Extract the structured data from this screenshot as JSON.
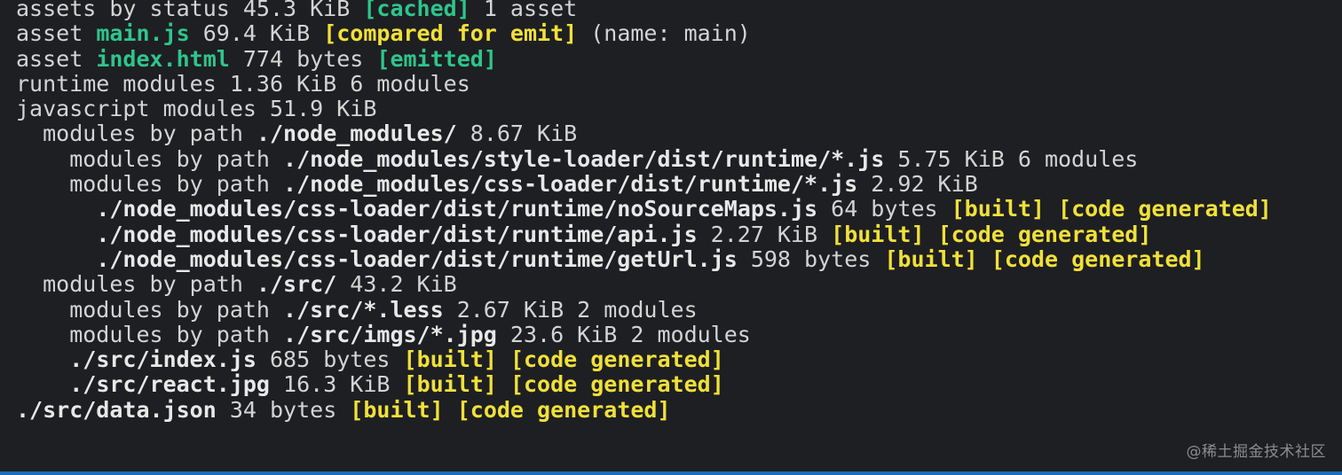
{
  "lines": [
    [
      {
        "t": "assets by status 45.3 KiB "
      },
      {
        "t": "[cached]",
        "c": "g"
      },
      {
        "t": " 1 asset"
      }
    ],
    [
      {
        "t": "asset "
      },
      {
        "t": "main.js",
        "c": "g"
      },
      {
        "t": " 69.4 KiB "
      },
      {
        "t": "[compared for emit]",
        "c": "y"
      },
      {
        "t": " (name: main)"
      }
    ],
    [
      {
        "t": "asset "
      },
      {
        "t": "index.html",
        "c": "g"
      },
      {
        "t": " 774 bytes "
      },
      {
        "t": "[emitted]",
        "c": "g"
      }
    ],
    [
      {
        "t": "runtime modules 1.36 KiB 6 modules"
      }
    ],
    [
      {
        "t": "javascript modules 51.9 KiB"
      }
    ],
    [
      {
        "t": "  modules by path "
      },
      {
        "t": "./node_modules/",
        "c": "w"
      },
      {
        "t": " 8.67 KiB"
      }
    ],
    [
      {
        "t": "    modules by path "
      },
      {
        "t": "./node_modules/style-loader/dist/runtime/*.js",
        "c": "w"
      },
      {
        "t": " 5.75 KiB 6 modules"
      }
    ],
    [
      {
        "t": "    modules by path "
      },
      {
        "t": "./node_modules/css-loader/dist/runtime/*.js",
        "c": "w"
      },
      {
        "t": " 2.92 KiB"
      }
    ],
    [
      {
        "t": "      "
      },
      {
        "t": "./node_modules/css-loader/dist/runtime/noSourceMaps.js",
        "c": "w"
      },
      {
        "t": " 64 bytes "
      },
      {
        "t": "[built]",
        "c": "y"
      },
      {
        "t": " "
      },
      {
        "t": "[code generated]",
        "c": "y"
      }
    ],
    [
      {
        "t": "      "
      },
      {
        "t": "./node_modules/css-loader/dist/runtime/api.js",
        "c": "w"
      },
      {
        "t": " 2.27 KiB "
      },
      {
        "t": "[built]",
        "c": "y"
      },
      {
        "t": " "
      },
      {
        "t": "[code generated]",
        "c": "y"
      }
    ],
    [
      {
        "t": "      "
      },
      {
        "t": "./node_modules/css-loader/dist/runtime/getUrl.js",
        "c": "w"
      },
      {
        "t": " 598 bytes "
      },
      {
        "t": "[built]",
        "c": "y"
      },
      {
        "t": " "
      },
      {
        "t": "[code generated]",
        "c": "y"
      }
    ],
    [
      {
        "t": "  modules by path "
      },
      {
        "t": "./src/",
        "c": "w"
      },
      {
        "t": " 43.2 KiB"
      }
    ],
    [
      {
        "t": "    modules by path "
      },
      {
        "t": "./src/*.less",
        "c": "w"
      },
      {
        "t": " 2.67 KiB 2 modules"
      }
    ],
    [
      {
        "t": "    modules by path "
      },
      {
        "t": "./src/imgs/*.jpg",
        "c": "w"
      },
      {
        "t": " 23.6 KiB 2 modules"
      }
    ],
    [
      {
        "t": "    "
      },
      {
        "t": "./src/index.js",
        "c": "w"
      },
      {
        "t": " 685 bytes "
      },
      {
        "t": "[built]",
        "c": "y"
      },
      {
        "t": " "
      },
      {
        "t": "[code generated]",
        "c": "y"
      }
    ],
    [
      {
        "t": "    "
      },
      {
        "t": "./src/react.jpg",
        "c": "w"
      },
      {
        "t": " 16.3 KiB "
      },
      {
        "t": "[built]",
        "c": "y"
      },
      {
        "t": " "
      },
      {
        "t": "[code generated]",
        "c": "y"
      }
    ],
    [
      {
        "t": ""
      },
      {
        "t": "./src/data.json",
        "c": "w"
      },
      {
        "t": " 34 bytes "
      },
      {
        "t": "[built]",
        "c": "y"
      },
      {
        "t": " "
      },
      {
        "t": "[code generated]",
        "c": "y"
      }
    ]
  ],
  "watermark": "@稀土掘金技术社区",
  "colors": {
    "background": "#1e1f22",
    "text": "#d4d4d4",
    "green": "#2ec58c",
    "yellow": "#f0e03a",
    "bottom_bar": "#1d6fb8"
  }
}
